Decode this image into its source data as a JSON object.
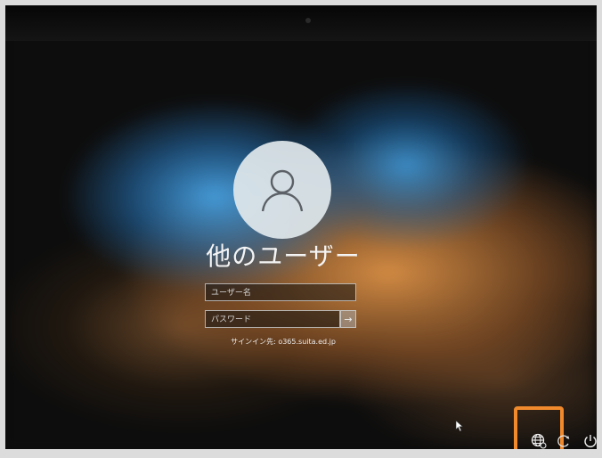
{
  "login": {
    "user_title": "他のユーザー",
    "username_placeholder": "ユーザー名",
    "password_placeholder": "パスワード",
    "submit_arrow": "→",
    "signin_domain": "サインイン先: o365.suita.ed.jp"
  },
  "icons": {
    "avatar": "user-avatar-icon",
    "network": "network-globe-icon",
    "accessibility": "ease-of-access-icon",
    "power": "power-icon",
    "cursor": "mouse-pointer-icon"
  },
  "colors": {
    "highlight": "#f08a2c",
    "text": "#f4f4f4"
  }
}
